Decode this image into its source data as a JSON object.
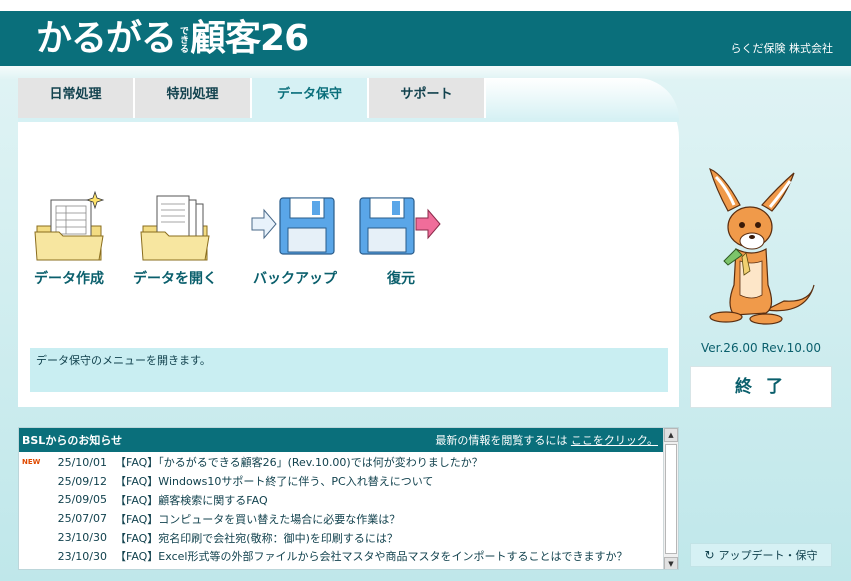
{
  "app": {
    "logo_main": "かるがる",
    "logo_small": "できる",
    "logo_product": "顧客26",
    "company": "らくだ保険 株式会社"
  },
  "tabs": [
    {
      "label": "日常処理",
      "active": false
    },
    {
      "label": "特別処理",
      "active": false
    },
    {
      "label": "データ保守",
      "active": true
    },
    {
      "label": "サポート",
      "active": false
    }
  ],
  "menu": [
    {
      "label": "データ作成",
      "icon": "folder-new-document-icon"
    },
    {
      "label": "データを開く",
      "icon": "folder-open-documents-icon"
    },
    {
      "label": "バックアップ",
      "icon": "backup-floppy-icon"
    },
    {
      "label": "復元",
      "icon": "restore-floppy-icon"
    }
  ],
  "status_message": "データ保守のメニューを開きます。",
  "version": "Ver.26.00 Rev.10.00",
  "exit_label": "終 了",
  "news": {
    "title": "BSLからのお知らせ",
    "link_prefix": "最新の情報を閲覧するには ",
    "link_text": "ここをクリック。",
    "items": [
      {
        "new": "NEW",
        "date": "25/10/01",
        "text": "【FAQ】「かるがるできる顧客26」(Rev.10.00)では何が変わりましたか？"
      },
      {
        "new": "",
        "date": "25/09/12",
        "text": "【FAQ】Windows10サポート終了に伴う、PC入れ替えについて"
      },
      {
        "new": "",
        "date": "25/09/05",
        "text": "【FAQ】顧客検索に関するFAQ"
      },
      {
        "new": "",
        "date": "25/07/07",
        "text": "【FAQ】コンピュータを買い替えた場合に必要な作業は？"
      },
      {
        "new": "",
        "date": "23/10/30",
        "text": "【FAQ】宛名印刷で会社宛(敬称：御中)を印刷するには？"
      },
      {
        "new": "",
        "date": "23/10/30",
        "text": "【FAQ】Excel形式等の外部ファイルから会社マスタや商品マスタをインポートすることはできますか？"
      }
    ]
  },
  "update_label": "アップデート・保守",
  "colors": {
    "header": "#0a6f7b",
    "accent_text": "#0a5f6c",
    "active_tab": "#d6f1f4",
    "inactive_tab": "#e4e4e4",
    "status_box": "#c9eef2",
    "new_badge": "#e04a00"
  }
}
